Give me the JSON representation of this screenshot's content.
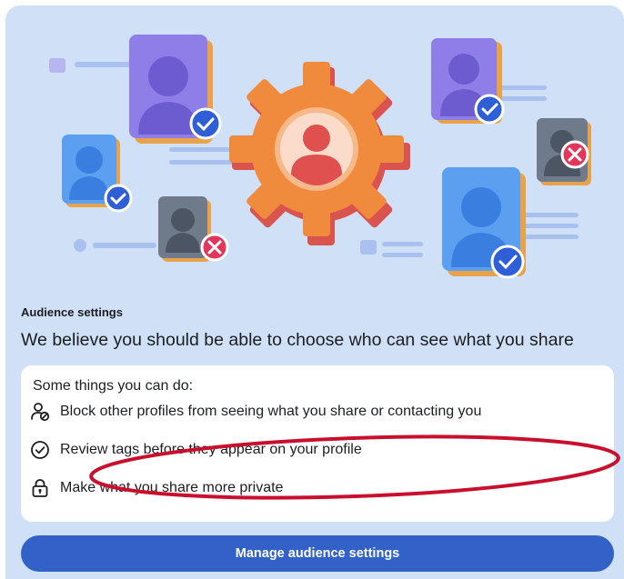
{
  "section": {
    "eyebrow": "Audience settings",
    "headline": "We believe you should be able to choose who can see what you share"
  },
  "options_panel": {
    "intro": "Some things you can do:",
    "items": [
      {
        "icon": "block-profile-icon",
        "label": "Block other profiles from seeing what you share or contacting you"
      },
      {
        "icon": "check-circle-icon",
        "label": "Review tags before they appear on your profile"
      },
      {
        "icon": "lock-icon",
        "label": "Make what you share more private"
      }
    ]
  },
  "cta": {
    "label": "Manage audience settings"
  },
  "colors": {
    "background": "#cfe0f7",
    "button": "#3262c8",
    "gear": "#f08a3c",
    "annotation": "#c8102e",
    "verified": "#2f5fd6",
    "rejected": "#e0375a"
  }
}
